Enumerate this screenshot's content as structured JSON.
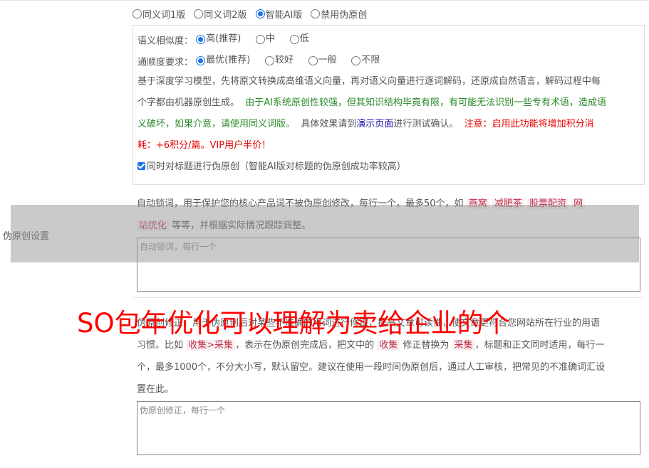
{
  "row_label": "伪原创设置",
  "version_options": [
    {
      "label": "同义词1版",
      "checked": false
    },
    {
      "label": "同义词2版",
      "checked": false
    },
    {
      "label": "智能AI版",
      "checked": true
    },
    {
      "label": "禁用伪原创",
      "checked": false
    }
  ],
  "similarity": {
    "label": "语义相似度：",
    "options": [
      {
        "label": "高(推荐)",
        "checked": true
      },
      {
        "label": "中",
        "checked": false
      },
      {
        "label": "低",
        "checked": false
      }
    ]
  },
  "fluency": {
    "label": "通顺度要求：",
    "options": [
      {
        "label": "最优(推荐)",
        "checked": true
      },
      {
        "label": "较好",
        "checked": false
      },
      {
        "label": "一般",
        "checked": false
      },
      {
        "label": "不限",
        "checked": false
      }
    ]
  },
  "ai_desc": {
    "line1": "基于深度学习模型，先将原文转换成高维语义向量，再对语义向量进行逐词解码，还原成自然语言，解码过程中每",
    "line2_gray": "个字都由机器原创生成。",
    "line2_green": "由于AI系统原创性较强，但其知识结构毕竟有限，有可能无法识别一些专有术语，造成语",
    "line3_green": "义破坏，如果介意，请使用同义词版。",
    "line3_gray_a": "具体效果请到",
    "line3_link": "演示页面",
    "line3_gray_b": "进行测试确认。",
    "line3_red": "注意：启用此功能将增加积分消",
    "line4_red": "耗：+6积分/篇。VIP用户半价！"
  },
  "title_checkbox": {
    "label": "同时对标题进行伪原创（智能AI版对标题的伪原创成功率较高）",
    "checked": true
  },
  "lock_words": {
    "desc_a": "自动锁词，用于保护您的核心产品词不被伪原创修改，每行一个，最多50个，如",
    "tags": [
      "燕窝",
      "减肥茶",
      "股票配资",
      "网"
    ],
    "tag_tail": "站优化",
    "desc_b": "等等，并根据实际情况跟踪调整。",
    "placeholder": "自动锁词，每行一个",
    "value": ""
  },
  "correction": {
    "line1_a": "伪原创修正，用于伪原创后对某些不准确的用词进行修正，提高文章可读性，使文章更符合您网站所在行业的用语",
    "line2_a": "习惯。比如",
    "line2_tag1": "收集>采集",
    "line2_b": "，表示在伪原创完成后，把文中的",
    "line2_tag2": "收集",
    "line2_c": "修正替换为",
    "line2_tag3": "采集",
    "line2_d": "，标题和正文同时适用，每行一",
    "line3": "个，最多1000个，不分大小写，默认留空。建议在使用一段时间伪原创后，通过人工审核，把常见的不准确词汇设",
    "line4": "置在此。",
    "placeholder": "伪原创修正，每行一个",
    "value": ""
  },
  "watermark": "SO包年优化可以理解为卖给企业的个"
}
